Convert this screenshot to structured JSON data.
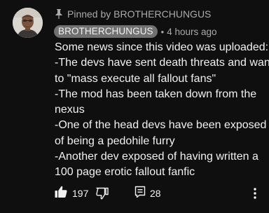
{
  "comment": {
    "pinned_label": "Pinned by BROTHERCHUNGUS",
    "author": "BROTHERCHUNGUS",
    "separator": "•",
    "timestamp": "4 hours ago",
    "body_lines": [
      "Some news since this video was uploaded:",
      "-The devs have sent death threats and want",
      "to \"mass execute all fallout fans\"",
      "-The mod has been taken down from the",
      "nexus",
      "-One of the head devs have been exposed",
      "of being a pedohile furry",
      "-Another dev exposed of having written a",
      "100 page erotic fallout fanfic"
    ]
  },
  "actions": {
    "like_count": "197",
    "reply_count": "28"
  },
  "icons": {
    "pin": "pin-icon",
    "like": "thumbs-up-icon",
    "dislike": "thumbs-down-icon",
    "reply": "reply-icon",
    "more": "more-vertical-icon"
  },
  "colors": {
    "background": "#0f0f0f",
    "text_primary": "#f1f1f1",
    "text_secondary": "#aaaaaa",
    "author_chip": "#717171"
  }
}
